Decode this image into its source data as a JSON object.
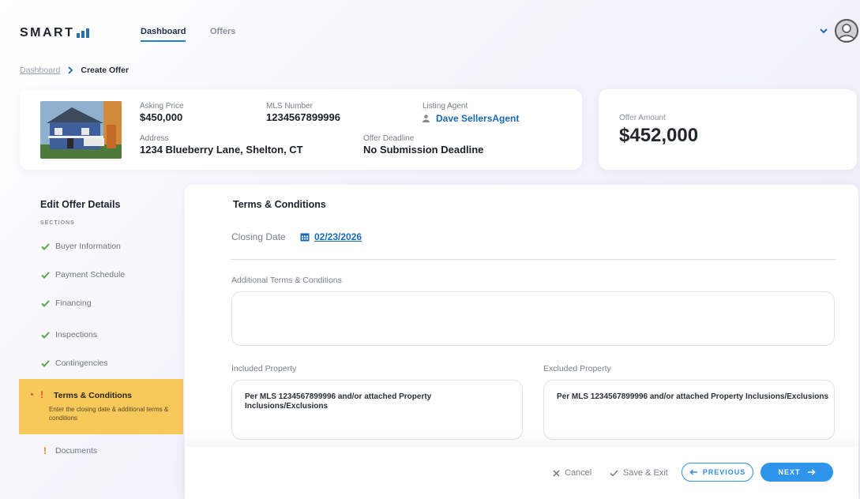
{
  "header": {
    "logo_text": "SMART",
    "tabs": [
      {
        "label": "Dashboard",
        "active": true
      },
      {
        "label": "Offers",
        "active": false
      }
    ],
    "icons": {
      "menu": "chevron-down-icon",
      "user": "user-avatar-icon"
    }
  },
  "breadcrumb": {
    "items": [
      "Dashboard",
      "Create Offer"
    ]
  },
  "listing": {
    "asking_price_label": "Asking Price",
    "asking_price": "$450,000",
    "mls_label": "MLS Number",
    "mls": "1234567899996",
    "agent_label": "Listing Agent",
    "agent": "Dave SellersAgent",
    "address_label": "Address",
    "address": "1234 Blueberry Lane, Shelton, CT",
    "deadline_label": "Offer Deadline",
    "deadline": "No Submission Deadline"
  },
  "offer": {
    "label": "Offer Amount",
    "amount": "$452,000"
  },
  "sidebar": {
    "title": "Edit Offer Details",
    "subtitle": "SECTIONS",
    "items": [
      {
        "label": "Buyer Information",
        "status": "complete"
      },
      {
        "label": "Payment Schedule",
        "status": "complete"
      },
      {
        "label": "Financing",
        "status": "complete"
      },
      {
        "label": "Inspections",
        "status": "complete"
      },
      {
        "label": "Contingencies",
        "status": "complete"
      },
      {
        "label": "Terms & Conditions",
        "status": "active",
        "description": "Enter the closing date & additional terms & conditions"
      },
      {
        "label": "Documents",
        "status": "incomplete"
      }
    ]
  },
  "form": {
    "section_title": "Terms & Conditions",
    "closing_date_label": "Closing Date",
    "closing_date": "02/23/2026",
    "additional_label": "Additional Terms & Conditions",
    "additional_value": "",
    "included_label": "Included Property",
    "included_value": "Per MLS 1234567899996 and/or attached Property Inclusions/Exclusions",
    "excluded_label": "Excluded Property",
    "excluded_value": "Per MLS 1234567899996 and/or attached Property Inclusions/Exclusions"
  },
  "footer": {
    "cancel": "Cancel",
    "save_exit": "Save & Exit",
    "previous": "PREVIOUS",
    "next": "NEXT"
  },
  "colors": {
    "accent": "#2e95ea",
    "link": "#1a69b5",
    "active_section": "#f7c85a",
    "check": "#5aa84a",
    "warning": "#e07a1a"
  }
}
